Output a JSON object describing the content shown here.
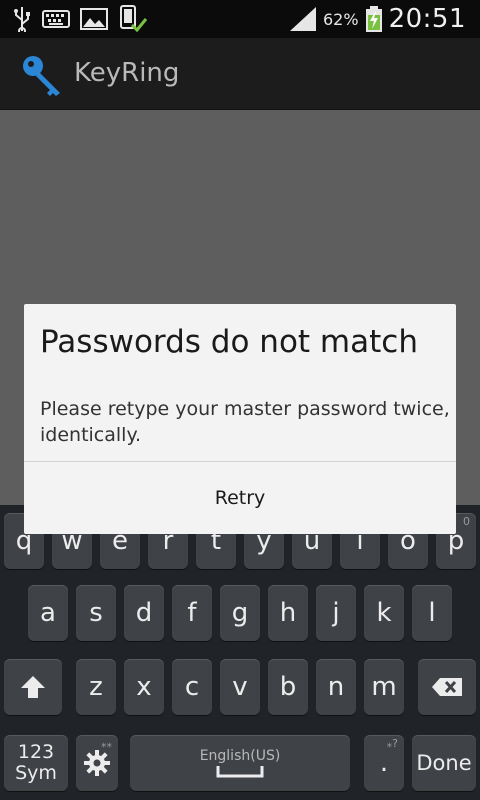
{
  "status_bar": {
    "battery_percent": "62%",
    "time": "20:51",
    "icons": [
      "usb-icon",
      "keyboard-icon",
      "gallery-icon",
      "device-check-icon",
      "signal-icon",
      "battery-charging-icon"
    ]
  },
  "action_bar": {
    "title": "KeyRing",
    "icon": "key-icon"
  },
  "dialog": {
    "title": "Passwords do not match",
    "message": "Please retype your master password twice, identically.",
    "button_label": "Retry"
  },
  "keyboard": {
    "row1": [
      "q",
      "w",
      "e",
      "r",
      "t",
      "y",
      "u",
      "i",
      "o",
      "p"
    ],
    "row1_sup_last": "0",
    "row2": [
      "a",
      "s",
      "d",
      "f",
      "g",
      "h",
      "j",
      "k",
      "l"
    ],
    "row3": [
      "z",
      "x",
      "c",
      "v",
      "b",
      "n",
      "m"
    ],
    "sym_label_1": "123",
    "sym_label_2": "Sym",
    "space_label": "English(US)",
    "period_label": ".",
    "done_label": "Done",
    "shift_icon": "shift-arrow-icon",
    "backspace_icon": "backspace-icon",
    "settings_icon": "gear-icon"
  }
}
